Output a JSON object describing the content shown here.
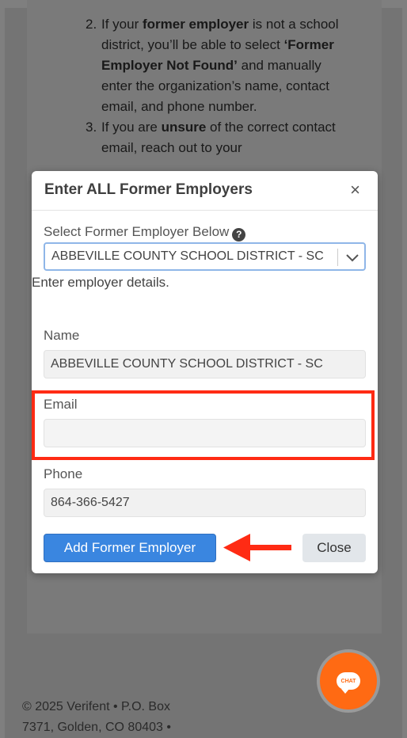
{
  "instructions": {
    "item2_num": "2.",
    "item2_text_a": "If your ",
    "item2_bold_a": "former employer",
    "item2_text_b": " is not a school district, you’ll be able to select ",
    "item2_bold_b": "‘Former Employer Not Found’",
    "item2_text_c": " and manually enter the organization’s name, contact email, and phone number.",
    "item3_num": "3.",
    "item3_text_a": "If you are ",
    "item3_bold_a": "unsure",
    "item3_text_b": " of the correct contact email, reach out to your"
  },
  "modal": {
    "title": "Enter ALL Former Employers",
    "close": "×",
    "select_label": "Select Former Employer Below",
    "help_icon": "?",
    "select_value": "ABBEVILLE COUNTY SCHOOL DISTRICT - SC",
    "helper_text": "Enter employer details.",
    "name_label": "Name",
    "name_value": "ABBEVILLE COUNTY SCHOOL DISTRICT - SC",
    "email_label": "Email",
    "email_value": "",
    "phone_label": "Phone",
    "phone_value": "864-366-5427",
    "add_button": "Add Former Employer",
    "close_button": "Close"
  },
  "chat": {
    "label": "CHAT"
  },
  "footer": {
    "line1": "© 2025 Verifent • P.O. Box",
    "line2": "7371, Golden, CO 80403 •"
  },
  "colors": {
    "primary": "#3a86e0",
    "highlight": "#ff2b14",
    "chat": "#ff6a13"
  }
}
